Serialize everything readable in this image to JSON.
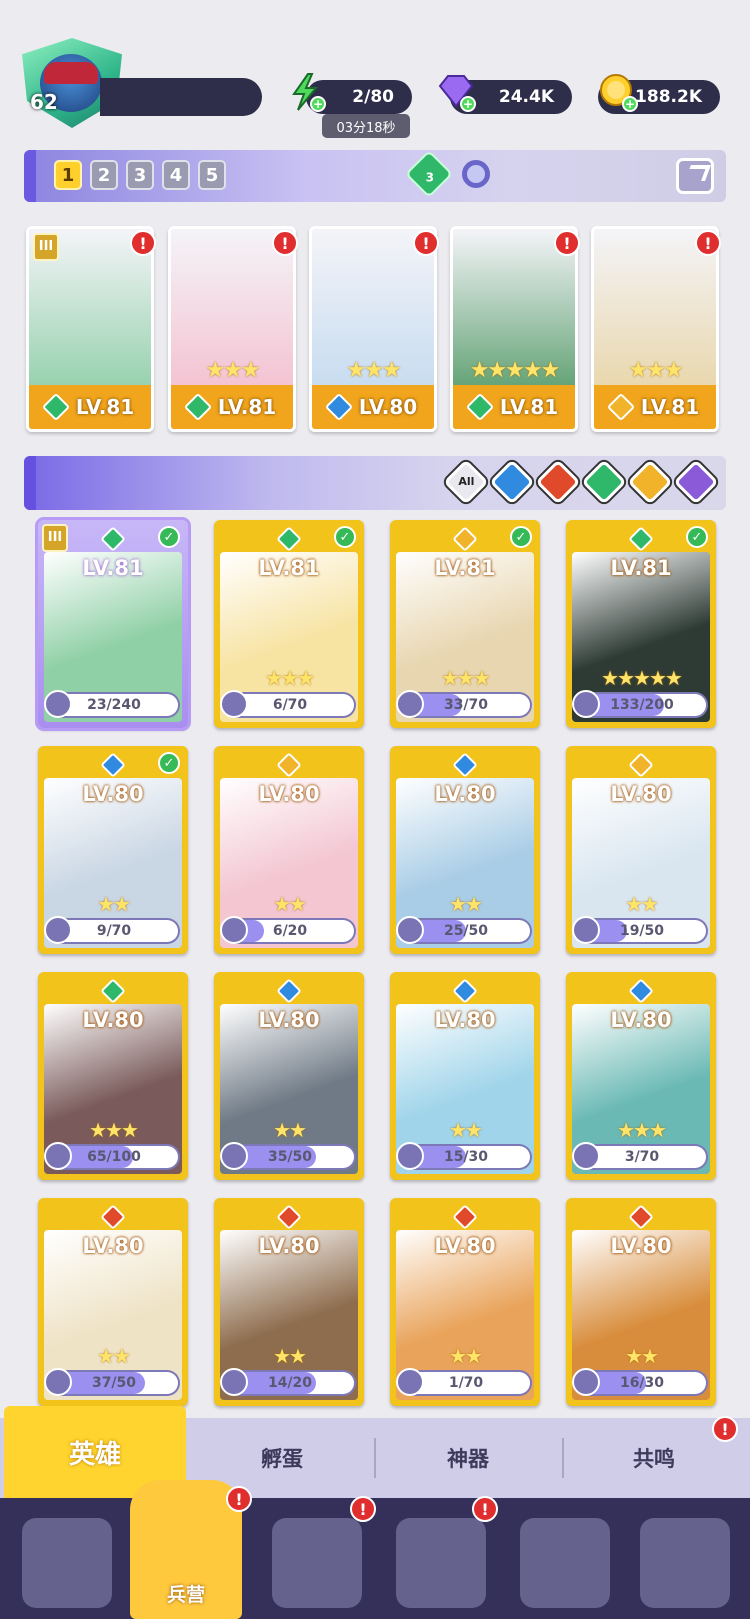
{
  "player": {
    "level": "62"
  },
  "resources": {
    "energy": "2/80",
    "energy_timer": "03分18秒",
    "gems": "24.4K",
    "gold": "188.2K"
  },
  "pages": [
    "1",
    "2",
    "3",
    "4",
    "5"
  ],
  "active_page": "1",
  "team_count": "3",
  "team": [
    {
      "level": "LV.81",
      "element": "nature",
      "rank": "III",
      "stars": "",
      "color": "#7ec89a"
    },
    {
      "level": "LV.81",
      "element": "nature",
      "stars": "★★★",
      "color": "#f4b6c8"
    },
    {
      "level": "LV.80",
      "element": "water",
      "stars": "★★★",
      "color": "#bcd6ee"
    },
    {
      "level": "LV.81",
      "element": "nature",
      "stars": "★★★★★",
      "color": "#3e8e54"
    },
    {
      "level": "LV.81",
      "element": "light",
      "stars": "★★★",
      "color": "#e6d09a"
    }
  ],
  "filters": [
    "All",
    "water",
    "fire",
    "nature",
    "light",
    "dark"
  ],
  "heroes": [
    {
      "level": "LV.81",
      "element": "nature",
      "progress": "23/240",
      "frac": 0.1,
      "stars": "",
      "checked": true,
      "rank": "III",
      "color": "#8fd0a6"
    },
    {
      "level": "LV.81",
      "element": "nature",
      "progress": "6/70",
      "frac": 0.09,
      "stars": "★★★",
      "checked": true,
      "color": "#f7e3a2"
    },
    {
      "level": "LV.81",
      "element": "light",
      "progress": "33/70",
      "frac": 0.47,
      "stars": "★★★",
      "checked": true,
      "color": "#e8d6b0"
    },
    {
      "level": "LV.81",
      "element": "nature",
      "progress": "133/200",
      "frac": 0.67,
      "stars": "★★★★★",
      "checked": true,
      "color": "#2e3b35"
    },
    {
      "level": "LV.80",
      "element": "water",
      "progress": "9/70",
      "frac": 0.13,
      "stars": "★★",
      "checked": true,
      "color": "#c9d6e4"
    },
    {
      "level": "LV.80",
      "element": "light",
      "progress": "6/20",
      "frac": 0.3,
      "stars": "★★",
      "checked": false,
      "color": "#f3c6d2"
    },
    {
      "level": "LV.80",
      "element": "water",
      "progress": "25/50",
      "frac": 0.5,
      "stars": "★★",
      "checked": false,
      "color": "#a9cde6"
    },
    {
      "level": "LV.80",
      "element": "light",
      "progress": "19/50",
      "frac": 0.38,
      "stars": "★★",
      "checked": false,
      "color": "#d9e6f0"
    },
    {
      "level": "LV.80",
      "element": "nature",
      "progress": "65/100",
      "frac": 0.65,
      "stars": "★★★",
      "checked": false,
      "color": "#7a5a5a"
    },
    {
      "level": "LV.80",
      "element": "water",
      "progress": "35/50",
      "frac": 0.7,
      "stars": "★★",
      "checked": false,
      "color": "#6f7a86"
    },
    {
      "level": "LV.80",
      "element": "water",
      "progress": "15/30",
      "frac": 0.5,
      "stars": "★★",
      "checked": false,
      "color": "#9fd4ea"
    },
    {
      "level": "LV.80",
      "element": "water",
      "progress": "3/70",
      "frac": 0.04,
      "stars": "★★★",
      "checked": false,
      "color": "#6ab9b4"
    },
    {
      "level": "LV.80",
      "element": "fire",
      "progress": "37/50",
      "frac": 0.74,
      "stars": "★★",
      "checked": false,
      "color": "#efe3c6"
    },
    {
      "level": "LV.80",
      "element": "fire",
      "progress": "14/20",
      "frac": 0.7,
      "stars": "★★",
      "checked": false,
      "color": "#8e6d4e"
    },
    {
      "level": "LV.80",
      "element": "fire",
      "progress": "1/70",
      "frac": 0.01,
      "stars": "★★",
      "checked": false,
      "color": "#e9a35a"
    },
    {
      "level": "LV.80",
      "element": "fire",
      "progress": "16/30",
      "frac": 0.53,
      "stars": "★★",
      "checked": false,
      "color": "#d88d3c"
    }
  ],
  "tabs": [
    "英雄",
    "孵蛋",
    "神器",
    "共鸣"
  ],
  "nav": {
    "active_label": "兵营"
  },
  "element_colors": {
    "nature": "#2fb86a",
    "water": "#2f8ae0",
    "fire": "#e04a2a",
    "light": "#f0b32a",
    "dark": "#8a5ad8"
  }
}
